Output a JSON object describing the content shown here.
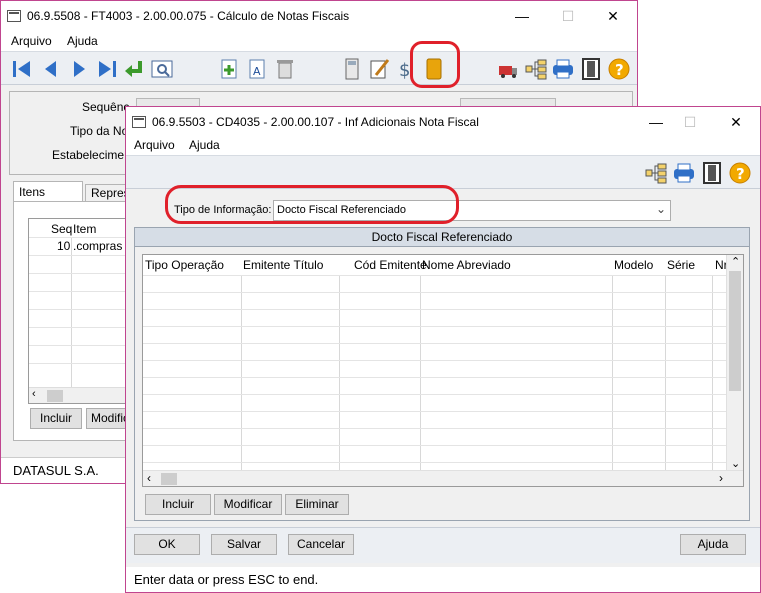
{
  "back_window": {
    "title": "06.9.5508 - FT4003 - 2.00.00.075 - Cálculo de Notas Fiscais",
    "menu": [
      "Arquivo",
      "Ajuda"
    ],
    "fields": [
      {
        "label": "Sequênc"
      },
      {
        "label": "Tipo da Not"
      },
      {
        "label": "Estabelecime"
      }
    ],
    "tabs": [
      "Itens",
      "Repres"
    ],
    "grid": {
      "headers": [
        "Seq",
        "Item"
      ],
      "rows": [
        {
          "seq": "10",
          "item": ".compras"
        }
      ]
    },
    "buttons": [
      "Incluir",
      "Modific"
    ],
    "status": "DATASUL S.A."
  },
  "front_window": {
    "title": "06.9.5503 - CD4035 - 2.00.00.107 - Inf Adicionais Nota Fiscal",
    "menu": [
      "Arquivo",
      "Ajuda"
    ],
    "tipo_informacao": {
      "label": "Tipo de Informação:",
      "value": "Docto Fiscal Referenciado"
    },
    "panel_title": "Docto Fiscal Referenciado",
    "grid": {
      "headers": [
        "Tipo Operação",
        "Emitente Título",
        "Cód Emitente",
        "Nome Abreviado",
        "Modelo",
        "Série",
        "Nr"
      ]
    },
    "grid_buttons": [
      "Incluir",
      "Modificar",
      "Eliminar"
    ],
    "footer_buttons": [
      "OK",
      "Salvar",
      "Cancelar",
      "Ajuda"
    ],
    "status": "Enter data or press ESC to end."
  },
  "colors": {
    "highlight": "#e0202a",
    "frame": "#c0458f",
    "panel_header": "#d6dde6"
  }
}
